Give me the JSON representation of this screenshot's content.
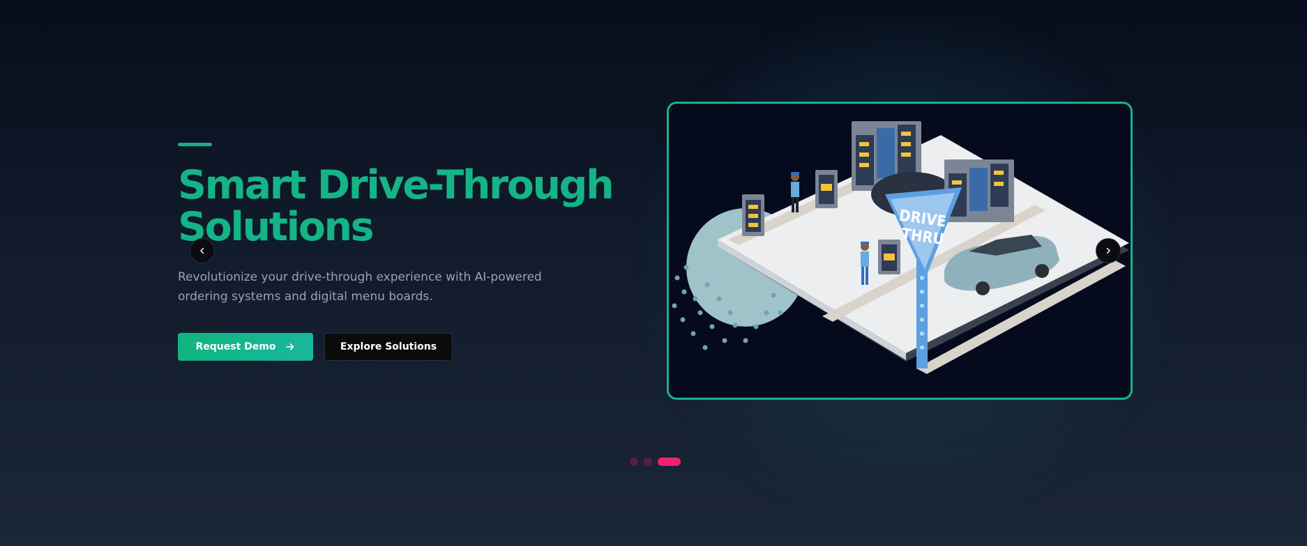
{
  "hero": {
    "title_line1": "Smart Drive-Through",
    "title_line2": "Solutions",
    "subtitle": "Revolutionize your drive-through experience with AI-powered ordering systems and digital menu boards.",
    "primary_button": "Request Demo",
    "secondary_button": "Explore Solutions"
  },
  "carousel": {
    "slide_sign_line1": "DRIVE",
    "slide_sign_line2": "THRU",
    "total_slides": 3,
    "active_slide": 3
  },
  "icons": {
    "prev": "chevron-left-icon",
    "next": "chevron-right-icon",
    "cta_arrow": "arrow-right-icon"
  },
  "colors": {
    "accent": "#14b486",
    "background_top": "#070d1c",
    "background_bottom": "#1b2637",
    "slide_border": "#18b48a",
    "active_dot": "#f0226b",
    "inactive_dot": "#5a1f3e"
  }
}
